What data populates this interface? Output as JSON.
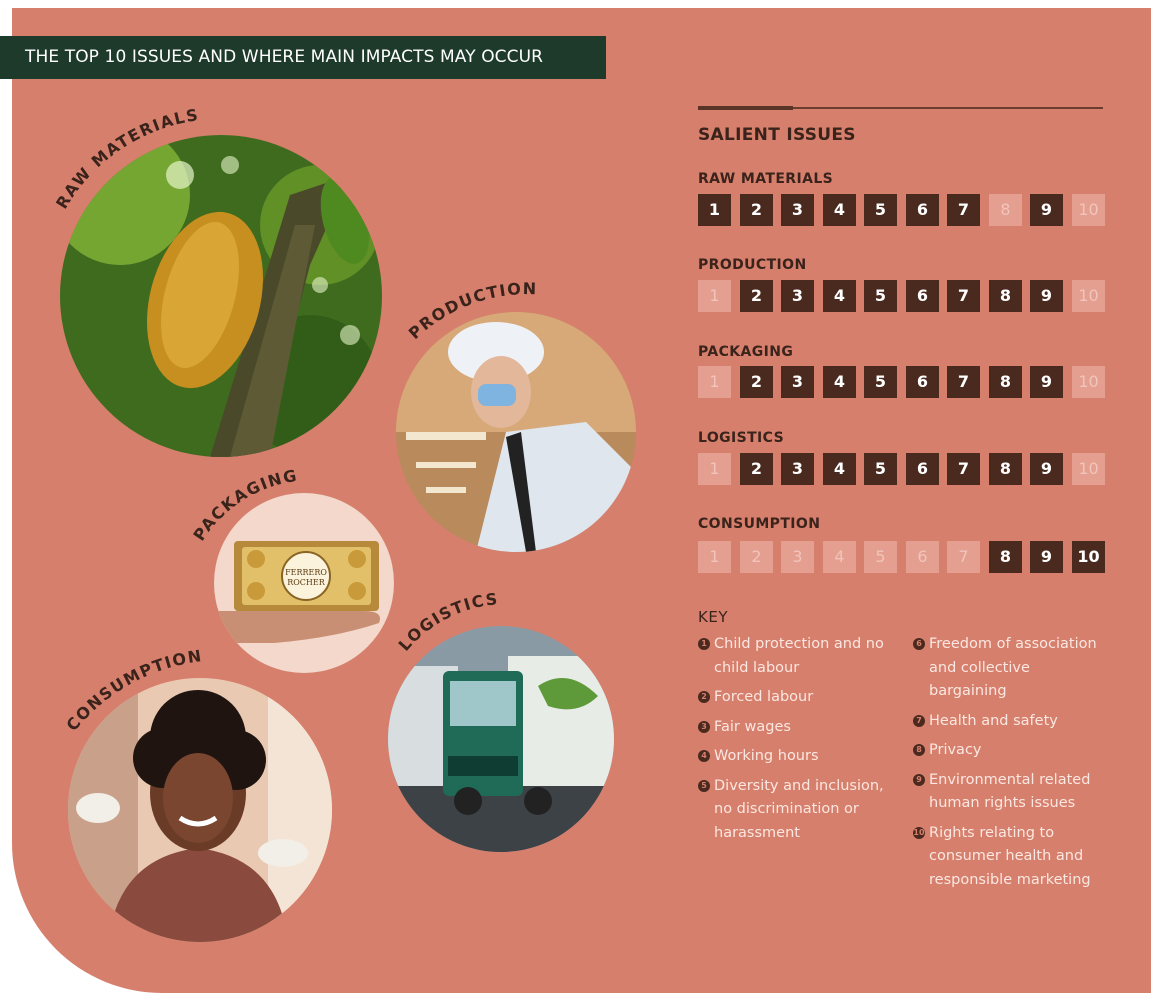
{
  "header": {
    "title": "THE TOP 10 ISSUES AND WHERE MAIN IMPACTS MAY OCCUR"
  },
  "colors": {
    "panel": "#d67f6c",
    "header_bar": "#1e3a2b",
    "box_on": "#4a2a1f",
    "box_off": "#e49f90"
  },
  "photos": {
    "raw_materials": {
      "label": "RAW MATERIALS"
    },
    "production": {
      "label": "PRODUCTION"
    },
    "packaging": {
      "label": "PACKAGING",
      "product_text_1": "FERRERO",
      "product_text_2": "ROCHER"
    },
    "logistics": {
      "label": "LOGISTICS"
    },
    "consumption": {
      "label": "CONSUMPTION"
    }
  },
  "salient": {
    "title": "SALIENT ISSUES",
    "stages": [
      {
        "label": "RAW MATERIALS",
        "boxes": [
          {
            "n": "1",
            "on": true
          },
          {
            "n": "2",
            "on": true
          },
          {
            "n": "3",
            "on": true
          },
          {
            "n": "4",
            "on": true
          },
          {
            "n": "5",
            "on": true
          },
          {
            "n": "6",
            "on": true
          },
          {
            "n": "7",
            "on": true
          },
          {
            "n": "8",
            "on": false
          },
          {
            "n": "9",
            "on": true
          },
          {
            "n": "10",
            "on": false
          }
        ]
      },
      {
        "label": "PRODUCTION",
        "boxes": [
          {
            "n": "1",
            "on": false
          },
          {
            "n": "2",
            "on": true
          },
          {
            "n": "3",
            "on": true
          },
          {
            "n": "4",
            "on": true
          },
          {
            "n": "5",
            "on": true
          },
          {
            "n": "6",
            "on": true
          },
          {
            "n": "7",
            "on": true
          },
          {
            "n": "8",
            "on": true
          },
          {
            "n": "9",
            "on": true
          },
          {
            "n": "10",
            "on": false
          }
        ]
      },
      {
        "label": "PACKAGING",
        "boxes": [
          {
            "n": "1",
            "on": false
          },
          {
            "n": "2",
            "on": true
          },
          {
            "n": "3",
            "on": true
          },
          {
            "n": "4",
            "on": true
          },
          {
            "n": "5",
            "on": true
          },
          {
            "n": "6",
            "on": true
          },
          {
            "n": "7",
            "on": true
          },
          {
            "n": "8",
            "on": true
          },
          {
            "n": "9",
            "on": true
          },
          {
            "n": "10",
            "on": false
          }
        ]
      },
      {
        "label": "LOGISTICS",
        "boxes": [
          {
            "n": "1",
            "on": false
          },
          {
            "n": "2",
            "on": true
          },
          {
            "n": "3",
            "on": true
          },
          {
            "n": "4",
            "on": true
          },
          {
            "n": "5",
            "on": true
          },
          {
            "n": "6",
            "on": true
          },
          {
            "n": "7",
            "on": true
          },
          {
            "n": "8",
            "on": true
          },
          {
            "n": "9",
            "on": true
          },
          {
            "n": "10",
            "on": false
          }
        ]
      },
      {
        "label": "CONSUMPTION",
        "boxes": [
          {
            "n": "1",
            "on": false
          },
          {
            "n": "2",
            "on": false
          },
          {
            "n": "3",
            "on": false
          },
          {
            "n": "4",
            "on": false
          },
          {
            "n": "5",
            "on": false
          },
          {
            "n": "6",
            "on": false
          },
          {
            "n": "7",
            "on": false
          },
          {
            "n": "8",
            "on": true
          },
          {
            "n": "9",
            "on": true
          },
          {
            "n": "10",
            "on": true
          }
        ]
      }
    ]
  },
  "key": {
    "title": "KEY",
    "items": [
      {
        "num": "1",
        "lines": [
          "Child protection and no",
          "child labour"
        ]
      },
      {
        "num": "2",
        "lines": [
          "Forced labour"
        ]
      },
      {
        "num": "3",
        "lines": [
          "Fair wages"
        ]
      },
      {
        "num": "4",
        "lines": [
          "Working hours"
        ]
      },
      {
        "num": "5",
        "lines": [
          "Diversity and inclusion,",
          "no discrimination or",
          "harassment"
        ]
      },
      {
        "num": "6",
        "lines": [
          "Freedom of association",
          "and collective",
          "bargaining"
        ]
      },
      {
        "num": "7",
        "lines": [
          "Health and safety"
        ]
      },
      {
        "num": "8",
        "lines": [
          "Privacy"
        ]
      },
      {
        "num": "9",
        "lines": [
          "Environmental related",
          "human rights issues"
        ]
      },
      {
        "num": "10",
        "lines": [
          "Rights relating to",
          "consumer health and",
          "responsible marketing"
        ]
      }
    ]
  }
}
